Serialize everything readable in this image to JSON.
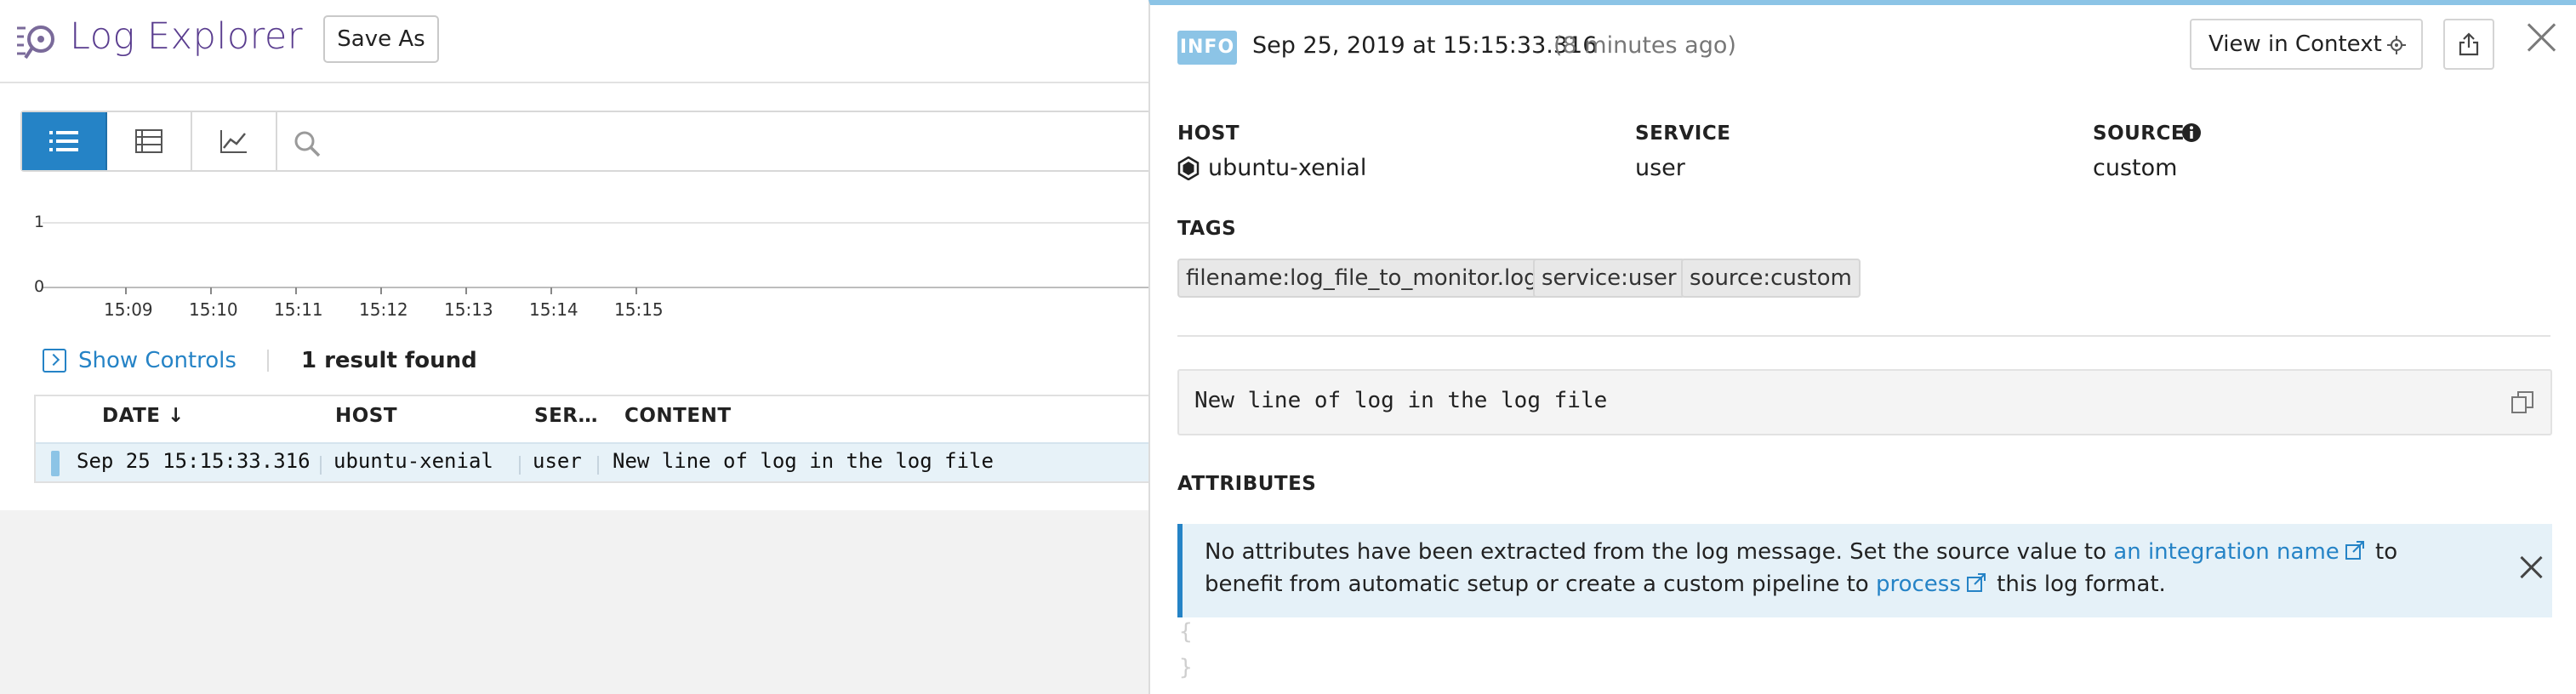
{
  "app": {
    "title": "Log Explorer",
    "save_as_label": "Save As"
  },
  "chart_data": {
    "type": "bar",
    "x": [
      "15:09",
      "15:10",
      "15:11",
      "15:12",
      "15:13",
      "15:14",
      "15:15"
    ],
    "y_ticks": [
      "1",
      "0"
    ],
    "ylim": [
      0,
      1
    ],
    "values": [
      0,
      0,
      0,
      0,
      0,
      0,
      0
    ]
  },
  "controls": {
    "show_controls_label": "Show Controls",
    "result_count": "1 result found"
  },
  "table": {
    "columns": [
      "DATE ↓",
      "HOST",
      "SER…",
      "CONTENT"
    ],
    "rows": [
      {
        "date": "Sep 25 15:15:33.316",
        "host": "ubuntu-xenial",
        "service": "user",
        "content": "New line of log in the log file"
      }
    ]
  },
  "panel": {
    "status": "INFO",
    "date": "Sep 25, 2019 at 15:15:33.316",
    "ago": "(8 minutes ago)",
    "view_in_context_label": "View in Context",
    "host_label": "HOST",
    "host_value": "ubuntu-xenial",
    "service_label": "SERVICE",
    "service_value": "user",
    "source_label": "SOURCE",
    "source_value": "custom",
    "tags_label": "TAGS",
    "tags": [
      "filename:log_file_to_monitor.log",
      "service:user",
      "source:custom"
    ],
    "message": "New line of log in the log file",
    "attributes_label": "ATTRIBUTES",
    "notice": {
      "part1": "No attributes have been extracted from the log message. Set the source value to ",
      "link1": "an integration name",
      "part2": " to benefit from automatic setup or create a custom pipeline to ",
      "link2": "process",
      "part3": " this log format."
    },
    "brace_open": "{",
    "brace_close": "}"
  },
  "colors": {
    "accent": "#2583c6",
    "brand": "#5a3d8f",
    "info": "#8cc4e6"
  }
}
